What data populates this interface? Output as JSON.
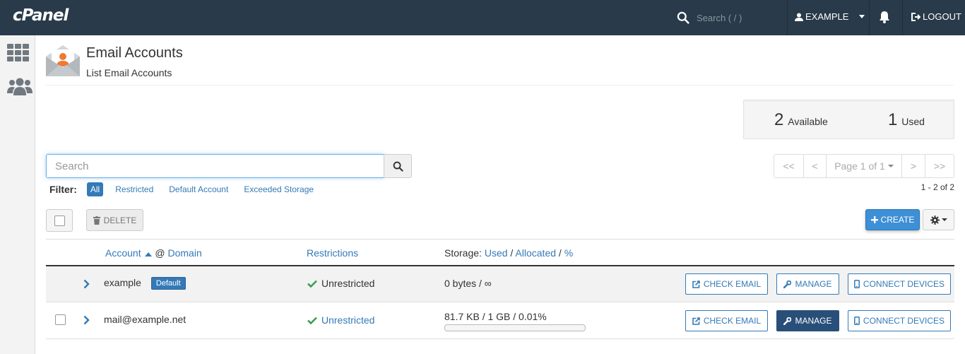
{
  "topbar": {
    "logo": "cPanel",
    "search_placeholder": "Search ( / )",
    "user": "EXAMPLE",
    "logout": "LOGOUT"
  },
  "sidebar": {
    "items": [
      {
        "icon": "grid-icon"
      },
      {
        "icon": "users-icon"
      }
    ]
  },
  "header": {
    "title": "Email Accounts",
    "subtitle": "List Email Accounts"
  },
  "stats": {
    "available_num": "2",
    "available_label": "Available",
    "used_num": "1",
    "used_label": "Used"
  },
  "search": {
    "placeholder": "Search"
  },
  "filter": {
    "label": "Filter:",
    "items": [
      "All",
      "Restricted",
      "Default Account",
      "Exceeded Storage"
    ],
    "active": "All"
  },
  "pagination": {
    "first": "<<",
    "prev": "<",
    "page": "Page 1 of 1",
    "next": ">",
    "last": ">>",
    "range": "1 - 2 of 2"
  },
  "toolbar": {
    "delete_label": "DELETE",
    "create_label": "CREATE"
  },
  "table": {
    "headers": {
      "account": "Account",
      "at": "@",
      "domain": "Domain",
      "restrictions": "Restrictions",
      "storage_prefix": "Storage:",
      "used": "Used",
      "sep1": "/",
      "allocated": "Allocated",
      "sep2": "/",
      "percent": "%"
    },
    "rows": [
      {
        "account": "example",
        "badge": "Default",
        "restriction": "Unrestricted",
        "storage": "0 bytes / ∞",
        "check_email": "CHECK EMAIL",
        "manage": "MANAGE",
        "connect": "CONNECT DEVICES"
      },
      {
        "account": "mail@example.net",
        "restriction": "Unrestricted",
        "storage": "81.7 KB / 1 GB / 0.01%",
        "storage_fraction": 0.0001,
        "check_email": "CHECK EMAIL",
        "manage": "MANAGE",
        "connect": "CONNECT DEVICES"
      }
    ]
  },
  "colors": {
    "topbar": "#293a4a",
    "link": "#337ab7",
    "success": "#3c9d4e",
    "create": "#3d8fd6"
  }
}
